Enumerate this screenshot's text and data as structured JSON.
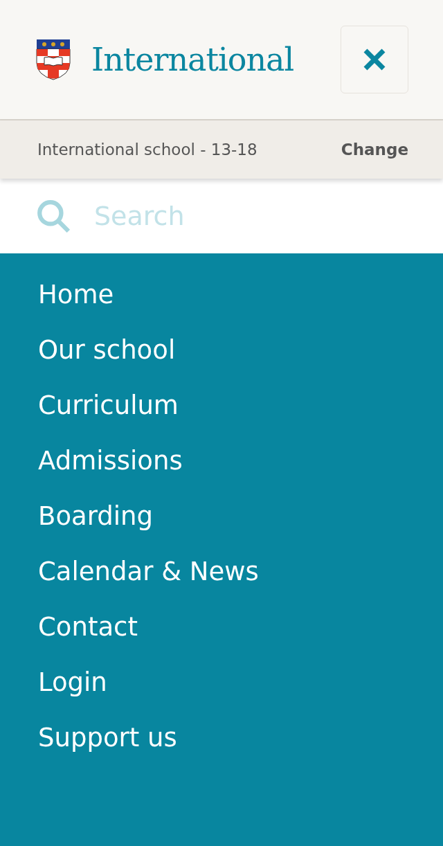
{
  "header": {
    "title": "International"
  },
  "school_bar": {
    "label": "International school - 13-18",
    "action": "Change"
  },
  "search": {
    "placeholder": "Search"
  },
  "nav": [
    {
      "label": "Home"
    },
    {
      "label": "Our school"
    },
    {
      "label": "Curriculum"
    },
    {
      "label": "Admissions"
    },
    {
      "label": "Boarding"
    },
    {
      "label": "Calendar & News"
    },
    {
      "label": "Contact"
    },
    {
      "label": "Login"
    },
    {
      "label": "Support us"
    }
  ]
}
